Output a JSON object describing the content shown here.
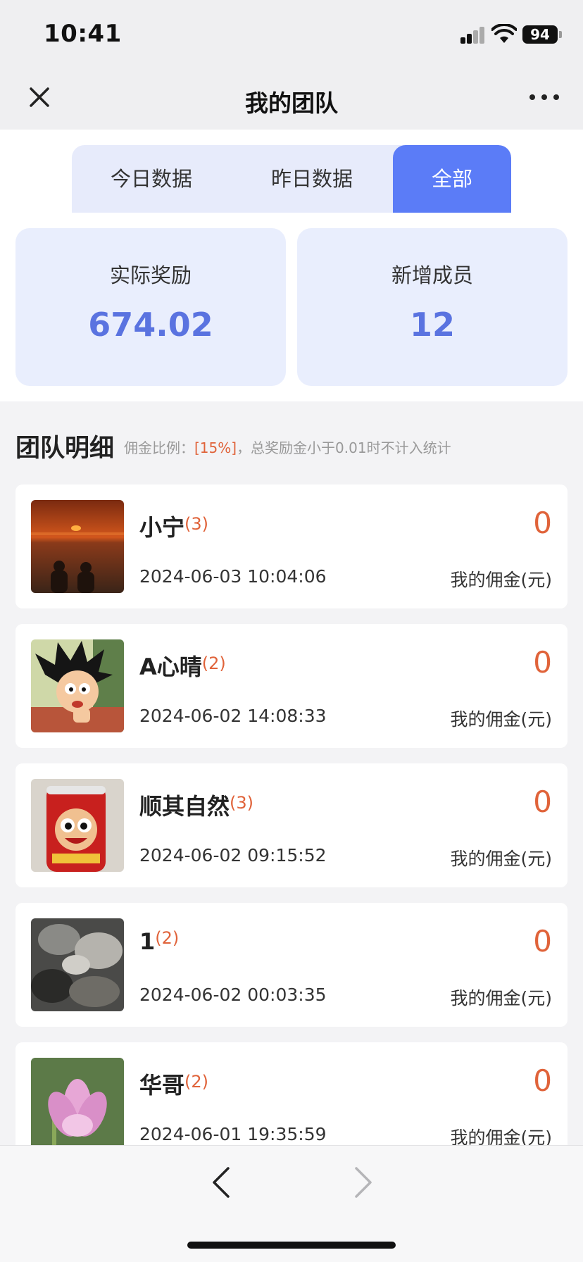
{
  "status_bar": {
    "time": "10:41",
    "battery": "94"
  },
  "nav": {
    "title": "我的团队",
    "close_icon": "close-icon",
    "more_icon": "more-icon"
  },
  "tabs": [
    {
      "label": "今日数据",
      "active": false
    },
    {
      "label": "昨日数据",
      "active": false
    },
    {
      "label": "全部",
      "active": true
    }
  ],
  "stats": [
    {
      "label": "实际奖励",
      "value": "674.02"
    },
    {
      "label": "新增成员",
      "value": "12"
    }
  ],
  "section": {
    "title": "团队明细",
    "note_prefix": "佣金比例：",
    "note_rate": "[15%]",
    "note_suffix": "，总奖励金小于0.01时不计入统计"
  },
  "members": [
    {
      "name": "小宁",
      "count": "(3)",
      "date": "2024-06-03 10:04:06",
      "amount": "0",
      "amount_label": "我的佣金(元)",
      "avatar": "sunset-photo"
    },
    {
      "name": "A心晴",
      "count": "(2)",
      "date": "2024-06-02 14:08:33",
      "amount": "0",
      "amount_label": "我的佣金(元)",
      "avatar": "cartoon-boy"
    },
    {
      "name": "顺其自然",
      "count": "(3)",
      "date": "2024-06-02 09:15:52",
      "amount": "0",
      "amount_label": "我的佣金(元)",
      "avatar": "red-can"
    },
    {
      "name": "1",
      "count": "(2)",
      "date": "2024-06-02 00:03:35",
      "amount": "0",
      "amount_label": "我的佣金(元)",
      "avatar": "rocks-photo"
    },
    {
      "name": "华哥",
      "count": "(2)",
      "date": "2024-06-01 19:35:59",
      "amount": "0",
      "amount_label": "我的佣金(元)",
      "avatar": "lotus-flower"
    }
  ],
  "colors": {
    "accent": "#5b7cf7",
    "stat_value": "#5a73e0",
    "highlight": "#e0633a",
    "stat_bg": "#e9eefd"
  }
}
